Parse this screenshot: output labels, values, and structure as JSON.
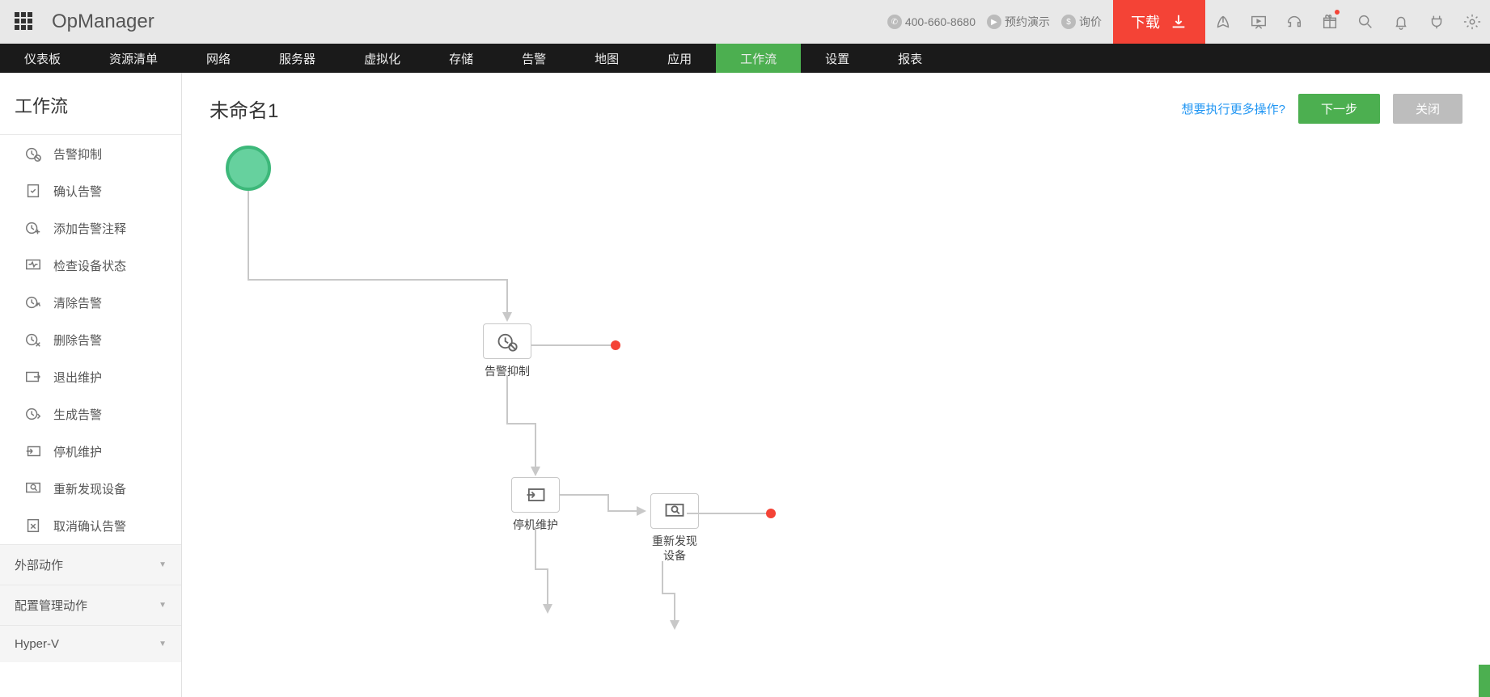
{
  "brand": "OpManager",
  "top": {
    "phone": "400-660-8680",
    "demo": "预约演示",
    "quote": "询价",
    "download": "下载"
  },
  "nav": {
    "items": [
      "仪表板",
      "资源清单",
      "网络",
      "服务器",
      "虚拟化",
      "存储",
      "告警",
      "地图",
      "应用",
      "工作流",
      "设置",
      "报表"
    ],
    "active_index": 9
  },
  "sidebar": {
    "title": "工作流",
    "actions": [
      {
        "label": "告警抑制",
        "icon": "clock-block"
      },
      {
        "label": "确认告警",
        "icon": "clipboard-check"
      },
      {
        "label": "添加告警注释",
        "icon": "clock-plus"
      },
      {
        "label": "检查设备状态",
        "icon": "monitor-pulse"
      },
      {
        "label": "清除告警",
        "icon": "clock-clear"
      },
      {
        "label": "删除告警",
        "icon": "clock-delete"
      },
      {
        "label": "退出维护",
        "icon": "exit-maint"
      },
      {
        "label": "生成告警",
        "icon": "clock-gen"
      },
      {
        "label": "停机维护",
        "icon": "enter-maint"
      },
      {
        "label": "重新发现设备",
        "icon": "rediscover"
      },
      {
        "label": "取消确认告警",
        "icon": "clipboard-x"
      }
    ],
    "groups": [
      "外部动作",
      "配置管理动作",
      "Hyper-V"
    ]
  },
  "canvas": {
    "title": "未命名1",
    "more_link": "想要执行更多操作?",
    "next_btn": "下一步",
    "close_btn": "关闭",
    "nodes": {
      "n1": {
        "label": "告警抑制"
      },
      "n2": {
        "label": "停机维护"
      },
      "n3": {
        "label": "重新发现\n设备",
        "line1": "重新发现",
        "line2": "设备"
      }
    }
  }
}
